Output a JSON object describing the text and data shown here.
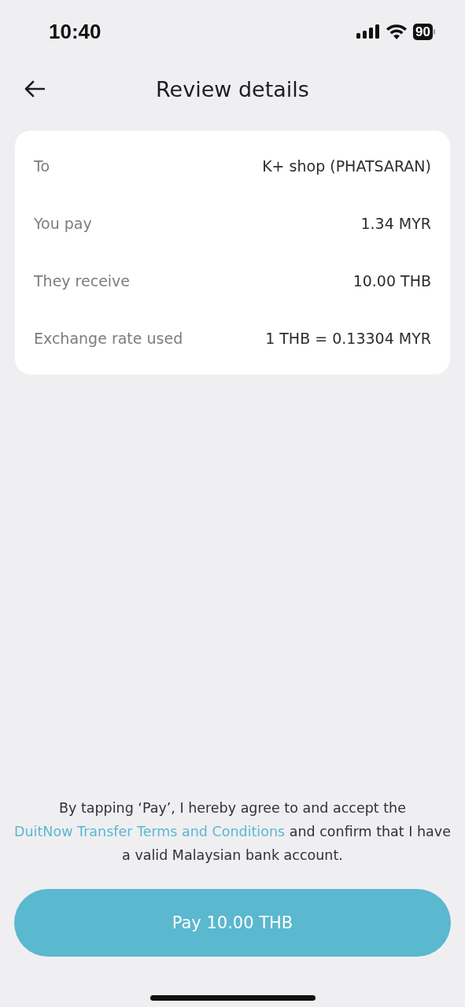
{
  "status_bar": {
    "time": "10:40",
    "battery": "90"
  },
  "header": {
    "title": "Review details"
  },
  "details": [
    {
      "label": "To",
      "value": "K+ shop (PHATSARAN)"
    },
    {
      "label": "You pay",
      "value": "1.34 MYR"
    },
    {
      "label": "They receive",
      "value": "10.00 THB"
    },
    {
      "label": "Exchange rate used",
      "value": "1 THB = 0.13304 MYR"
    }
  ],
  "agreement": {
    "before": "By tapping ‘Pay’, I hereby agree to and accept the",
    "link": "DuitNow Transfer Terms and Conditions",
    "after": "and confirm that I have a valid Malaysian bank account."
  },
  "pay_button": {
    "label": "Pay 10.00 THB"
  }
}
